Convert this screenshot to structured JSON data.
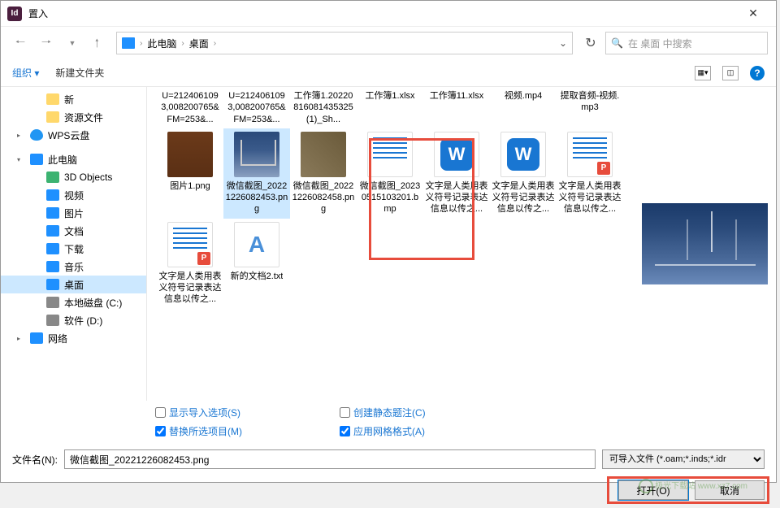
{
  "titlebar": {
    "app_icon_text": "Id",
    "title": "置入"
  },
  "breadcrumb": {
    "seg1": "此电脑",
    "seg2": "桌面"
  },
  "search": {
    "placeholder": "在 桌面 中搜索"
  },
  "toolbar": {
    "organize": "组织",
    "new_folder": "新建文件夹"
  },
  "sidebar": {
    "items": [
      {
        "label": "新",
        "icon": "folder",
        "level": 2
      },
      {
        "label": "资源文件",
        "icon": "folder",
        "level": 2
      },
      {
        "label": "WPS云盘",
        "icon": "cloud",
        "level": 1,
        "exp": "▸"
      },
      {
        "label": "此电脑",
        "icon": "pc",
        "level": 1,
        "exp": "▾"
      },
      {
        "label": "3D Objects",
        "icon": "obj",
        "level": 2
      },
      {
        "label": "视频",
        "icon": "vid",
        "level": 2
      },
      {
        "label": "图片",
        "icon": "img",
        "level": 2
      },
      {
        "label": "文档",
        "icon": "doc",
        "level": 2
      },
      {
        "label": "下载",
        "icon": "dl",
        "level": 2
      },
      {
        "label": "音乐",
        "icon": "mus",
        "level": 2
      },
      {
        "label": "桌面",
        "icon": "desk",
        "level": 2,
        "selected": true
      },
      {
        "label": "本地磁盘 (C:)",
        "icon": "disk",
        "level": 2
      },
      {
        "label": "软件 (D:)",
        "icon": "disk",
        "level": 2
      },
      {
        "label": "网络",
        "icon": "net",
        "level": 1,
        "exp": "▸"
      }
    ]
  },
  "files_row1": [
    {
      "label": "U=2124061093,008200765&FM=253&..."
    },
    {
      "label": "U=2124061093,008200765&FM=253&..."
    },
    {
      "label": "工作簿1.20220816081435325(1)_Sh..."
    },
    {
      "label": "工作簿1.xlsx"
    },
    {
      "label": "工作簿11.xlsx"
    },
    {
      "label": "视频.mp4"
    },
    {
      "label": "提取音频-视频.mp3"
    }
  ],
  "files_row2": [
    {
      "label": "图片1.png",
      "thumb": "leather"
    },
    {
      "label": "微信截图_20221226082453.png",
      "thumb": "bridge",
      "selected": true
    },
    {
      "label": "微信截图_20221226082458.png",
      "thumb": "city"
    },
    {
      "label": "微信截图_20230515103201.bmp",
      "thumb": "doc-page-plain"
    },
    {
      "label": "文字是人类用表义符号记录表达信息以传之...",
      "thumb": "doc-w"
    },
    {
      "label": "文字是人类用表义符号记录表达信息以传之...",
      "thumb": "doc-w"
    },
    {
      "label": "文字是人类用表义符号记录表达信息以传之...",
      "thumb": "doc-page",
      "badge": "P"
    }
  ],
  "files_row3": [
    {
      "label": "文字是人类用表义符号记录表达信息以传之...",
      "thumb": "doc-page",
      "badge": "P"
    },
    {
      "label": "新的文档2.txt",
      "thumb": "txtfile"
    }
  ],
  "options": {
    "show_import": "显示导入选项(S)",
    "replace_sel": "替换所选项目(M)",
    "static_caption": "创建静态题注(C)",
    "grid_format": "应用网格格式(A)"
  },
  "filename": {
    "label": "文件名(N):",
    "value": "微信截图_20221226082453.png",
    "filter": "可导入文件 (*.oam;*.inds;*.idr"
  },
  "buttons": {
    "open": "打开(O)",
    "cancel": "取消"
  },
  "watermark": "极光下载站 www.xz7.com"
}
